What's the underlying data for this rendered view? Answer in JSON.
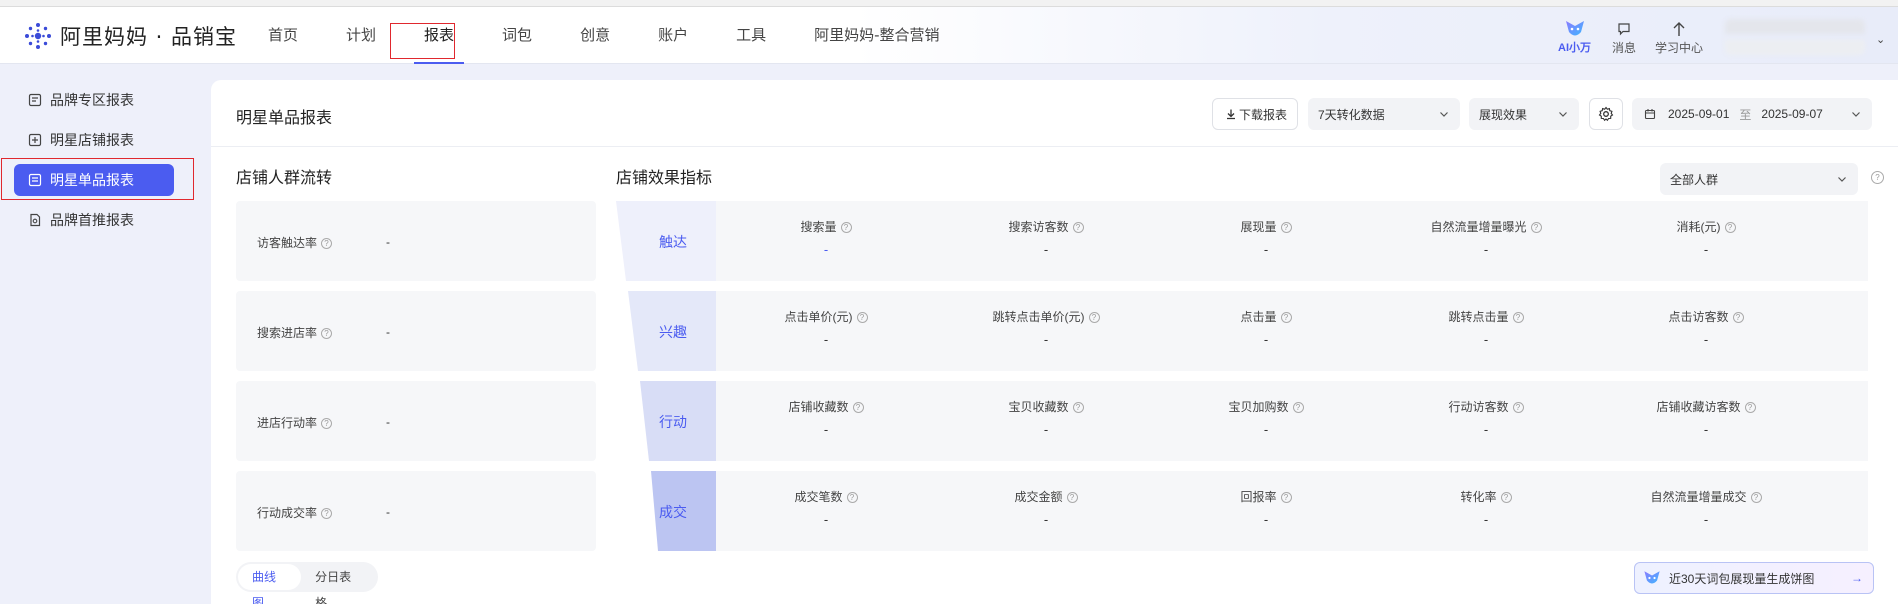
{
  "brand": {
    "name": "阿里妈妈 · 品销宝",
    "accent": "#4b5cf0"
  },
  "nav": {
    "items": [
      {
        "label": "首页"
      },
      {
        "label": "计划"
      },
      {
        "label": "报表",
        "active": true
      },
      {
        "label": "词包"
      },
      {
        "label": "创意"
      },
      {
        "label": "账户"
      },
      {
        "label": "工具"
      },
      {
        "label": "阿里妈妈-整合营销"
      }
    ]
  },
  "header_right": {
    "ai_label": "AI小万",
    "messages_label": "消息",
    "learn_label": "学习中心"
  },
  "sidebar": {
    "items": [
      {
        "label": "品牌专区报表"
      },
      {
        "label": "明星店铺报表"
      },
      {
        "label": "明星单品报表",
        "active": true
      },
      {
        "label": "品牌首推报表"
      }
    ]
  },
  "report": {
    "title": "明星单品报表",
    "download_label": "下载报表",
    "conversion_select": "7天转化数据",
    "effect_select": "展现效果",
    "date_start": "2025-09-01",
    "date_sep": "至",
    "date_end": "2025-09-07"
  },
  "flow": {
    "title": "店铺人群流转",
    "rows": [
      {
        "label": "访客触达率",
        "value": "-"
      },
      {
        "label": "搜索进店率",
        "value": "-"
      },
      {
        "label": "进店行动率",
        "value": "-"
      },
      {
        "label": "行动成交率",
        "value": "-"
      }
    ]
  },
  "effect": {
    "title": "店铺效果指标",
    "audience_select": "全部人群",
    "stages": [
      {
        "name": "触达",
        "metrics": [
          {
            "label": "搜索量",
            "value": "-"
          },
          {
            "label": "搜索访客数",
            "value": "-"
          },
          {
            "label": "展现量",
            "value": "-"
          },
          {
            "label": "自然流量增量曝光",
            "value": "-"
          },
          {
            "label": "消耗(元)",
            "value": "-"
          }
        ]
      },
      {
        "name": "兴趣",
        "metrics": [
          {
            "label": "点击单价(元)",
            "value": "-"
          },
          {
            "label": "跳转点击单价(元)",
            "value": "-"
          },
          {
            "label": "点击量",
            "value": "-"
          },
          {
            "label": "跳转点击量",
            "value": "-"
          },
          {
            "label": "点击访客数",
            "value": "-"
          }
        ]
      },
      {
        "name": "行动",
        "metrics": [
          {
            "label": "店铺收藏数",
            "value": "-"
          },
          {
            "label": "宝贝收藏数",
            "value": "-"
          },
          {
            "label": "宝贝加购数",
            "value": "-"
          },
          {
            "label": "行动访客数",
            "value": "-"
          },
          {
            "label": "店铺收藏访客数",
            "value": "-"
          }
        ]
      },
      {
        "name": "成交",
        "metrics": [
          {
            "label": "成交笔数",
            "value": "-"
          },
          {
            "label": "成交金额",
            "value": "-"
          },
          {
            "label": "回报率",
            "value": "-"
          },
          {
            "label": "转化率",
            "value": "-"
          },
          {
            "label": "自然流量增量成交",
            "value": "-"
          }
        ]
      }
    ]
  },
  "bottom": {
    "tab_curve": "曲线图",
    "tab_daily": "分日表格",
    "generate_label": "近30天词包展现量生成饼图"
  }
}
